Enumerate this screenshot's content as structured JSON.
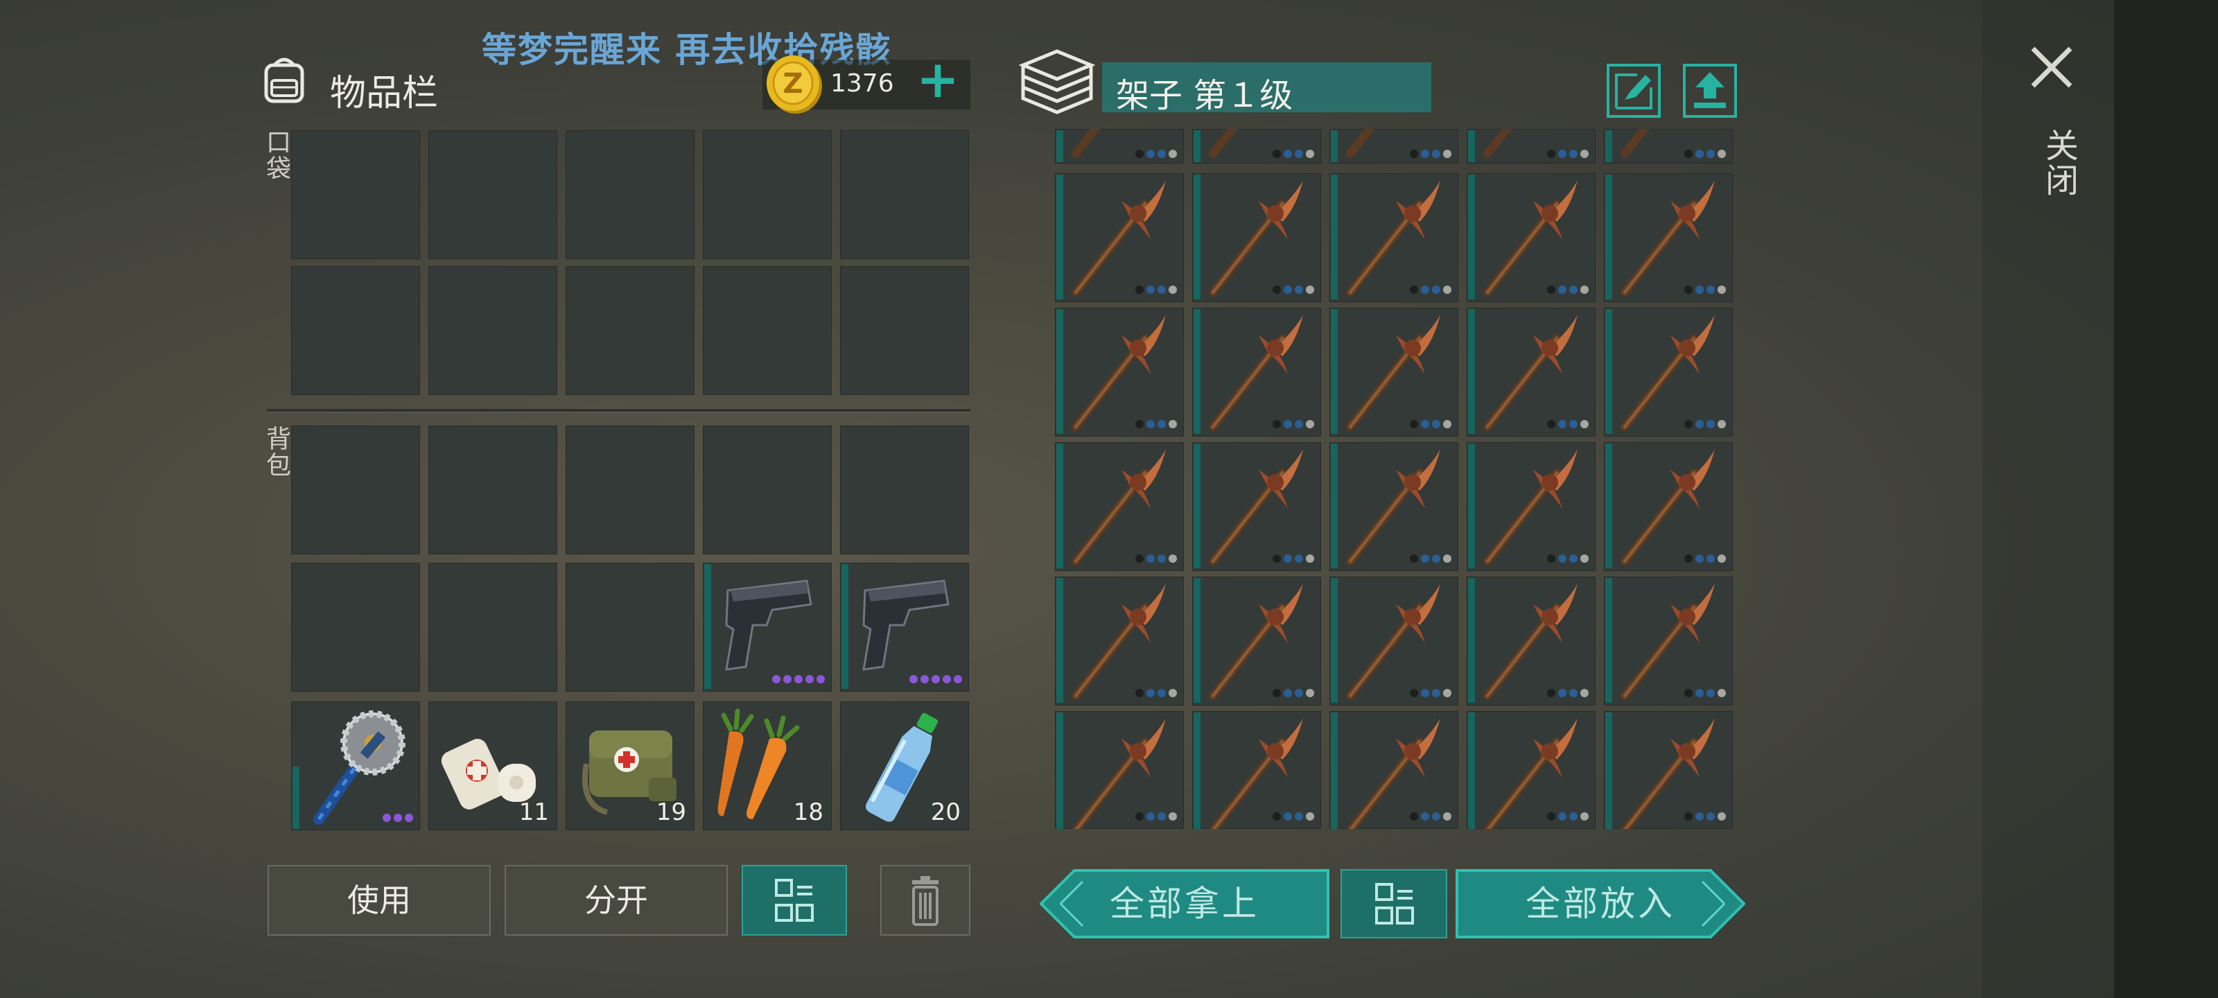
{
  "banner": "等梦完醒来 再去收拾残骸",
  "inventory": {
    "title": "物品栏",
    "pocket_label": "口袋",
    "backpack_label": "背包",
    "coins": "1376"
  },
  "backpack_items": [
    {
      "name": "saw-mace",
      "qty": ""
    },
    {
      "name": "bandage",
      "qty": "11"
    },
    {
      "name": "medkit-bag",
      "qty": "19"
    },
    {
      "name": "carrots",
      "qty": "18"
    },
    {
      "name": "water-bottle",
      "qty": "20"
    }
  ],
  "buttons": {
    "use": "使用",
    "split": "分开",
    "take_all": "全部拿上",
    "put_all": "全部放入"
  },
  "storage": {
    "title": "架子 第１级",
    "item": "wooden-pickaxe"
  },
  "close_label": "关闭",
  "colors": {
    "accent": "#27b3a2",
    "teal_dark": "#1f6f69",
    "slot": "#343a37"
  }
}
